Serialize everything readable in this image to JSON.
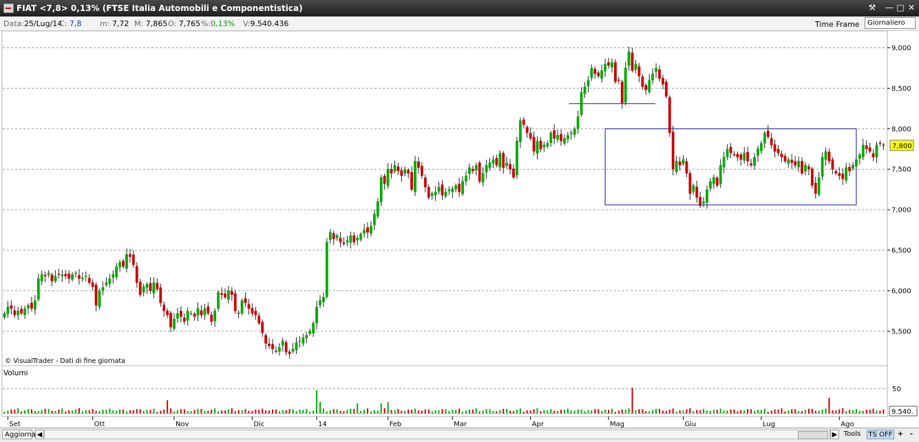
{
  "window": {
    "title": "FIAT <7,8> 0,13%  (FTSE Italia Automobili e Componentistica)",
    "buttons": [
      "wrench-icon",
      "minimize-icon",
      "maximize-icon",
      "close-icon"
    ]
  },
  "info_bar": {
    "data_label": "Data:",
    "data_value": "25/Lug/14",
    "close_label": "C:",
    "close_value": "7,8",
    "min_label": "m:",
    "min_value": "7,72",
    "max_label": "M:",
    "max_value": "7,865",
    "open_label": "O:",
    "open_value": "7,765",
    "pct_label": "%:",
    "pct_value": "0,13%",
    "vol_label": "V:",
    "vol_value": "9.540.436",
    "timeframe_label": "Time Frame",
    "timeframe_value": "Giornaliero"
  },
  "watermark": "© VisualTrader - Dati di fine giornata",
  "volume_panel": {
    "title": "Volumi",
    "tick_label": "50",
    "last_value_label": "9.540."
  },
  "bottom_bar": {
    "refresh": "Aggiorna",
    "tools": "Tools",
    "ts": "TS OFF",
    "plus": "+",
    "minus": "-"
  },
  "colors": {
    "up": "#00aa00",
    "down": "#cc0000",
    "annotation": "#1010a0",
    "grid": "#9a9a9a",
    "price_tag": "#ffff00"
  },
  "chart_data": {
    "type": "candlestick",
    "price_axis": {
      "ticks": [
        "9,000",
        "8,500",
        "8,000",
        "7,500",
        "7,000",
        "6,500",
        "6,000",
        "5,500"
      ],
      "range": [
        5.1,
        9.1
      ]
    },
    "months": [
      "Set",
      "Ott",
      "Nov",
      "Dic",
      "14",
      "Feb",
      "Mar",
      "Apr",
      "Mag",
      "Giu",
      "Lug",
      "Ago"
    ],
    "last_price_label": "7,800",
    "annotations": [
      {
        "type": "horizontal_line",
        "price": 8.31,
        "from_date": "2014-04-10",
        "to_date": "2014-05-15"
      },
      {
        "type": "range_box",
        "top": 8.0,
        "bottom": 7.06,
        "from_date": "2014-04-29",
        "to_date": "2014-07-28"
      }
    ],
    "closes": [
      5.72,
      5.8,
      5.78,
      5.7,
      5.75,
      5.72,
      5.78,
      5.82,
      5.78,
      5.88,
      6.15,
      6.2,
      6.18,
      6.22,
      6.12,
      6.18,
      6.2,
      6.2,
      6.18,
      6.15,
      6.2,
      6.22,
      6.15,
      6.16,
      6.18,
      6.1,
      6.05,
      5.82,
      6.0,
      6.04,
      6.1,
      6.15,
      6.2,
      6.3,
      6.35,
      6.3,
      6.45,
      6.42,
      6.32,
      6.1,
      5.95,
      6.05,
      6.08,
      6.0,
      6.1,
      6.02,
      5.85,
      5.75,
      5.7,
      5.55,
      5.65,
      5.72,
      5.68,
      5.62,
      5.75,
      5.72,
      5.68,
      5.78,
      5.7,
      5.78,
      5.72,
      5.62,
      5.75,
      5.98,
      5.95,
      5.92,
      6.0,
      5.95,
      5.75,
      5.72,
      5.88,
      5.85,
      5.78,
      5.72,
      5.7,
      5.6,
      5.48,
      5.35,
      5.32,
      5.28,
      5.25,
      5.3,
      5.38,
      5.24,
      5.22,
      5.28,
      5.36,
      5.38,
      5.42,
      5.45,
      5.5,
      5.6,
      5.8,
      5.88,
      5.92,
      6.6,
      6.72,
      6.64,
      6.68,
      6.6,
      6.58,
      6.62,
      6.68,
      6.6,
      6.65,
      6.7,
      6.75,
      6.72,
      6.8,
      6.95,
      7.1,
      7.4,
      7.32,
      7.5,
      7.45,
      7.55,
      7.48,
      7.42,
      7.5,
      7.45,
      7.25,
      7.6,
      7.52,
      7.42,
      7.28,
      7.15,
      7.2,
      7.22,
      7.28,
      7.18,
      7.22,
      7.25,
      7.26,
      7.3,
      7.22,
      7.35,
      7.42,
      7.52,
      7.48,
      7.55,
      7.35,
      7.45,
      7.55,
      7.58,
      7.62,
      7.55,
      7.7,
      7.52,
      7.58,
      7.5,
      7.4,
      7.85,
      8.1,
      8.05,
      7.95,
      7.88,
      7.72,
      7.85,
      7.75,
      7.8,
      7.82,
      7.95,
      7.88,
      7.92,
      7.85,
      7.88,
      7.92,
      7.95,
      8.0,
      8.15,
      8.45,
      8.52,
      8.6,
      8.75,
      8.68,
      8.65,
      8.72,
      8.8,
      8.78,
      8.82,
      8.58,
      8.6,
      8.32,
      8.75,
      8.95,
      8.72,
      8.8,
      8.65,
      8.52,
      8.48,
      8.6,
      8.68,
      8.75,
      8.62,
      8.55,
      8.4,
      7.95,
      7.5,
      7.6,
      7.55,
      7.62,
      7.45,
      7.2,
      7.3,
      7.15,
      7.05,
      7.1,
      7.25,
      7.35,
      7.4,
      7.3,
      7.55,
      7.65,
      7.75,
      7.7,
      7.68,
      7.65,
      7.62,
      7.7,
      7.6,
      7.55,
      7.65,
      7.75,
      7.82,
      7.95,
      7.9,
      7.8,
      7.72,
      7.7,
      7.65,
      7.6,
      7.62,
      7.58,
      7.55,
      7.6,
      7.45,
      7.55,
      7.5,
      7.3,
      7.2,
      7.4,
      7.65,
      7.72,
      7.6,
      7.5,
      7.45,
      7.42,
      7.38,
      7.52,
      7.48,
      7.55,
      7.62,
      7.68,
      7.8,
      7.75,
      7.72,
      7.65,
      7.8,
      7.82,
      7.8
    ]
  }
}
